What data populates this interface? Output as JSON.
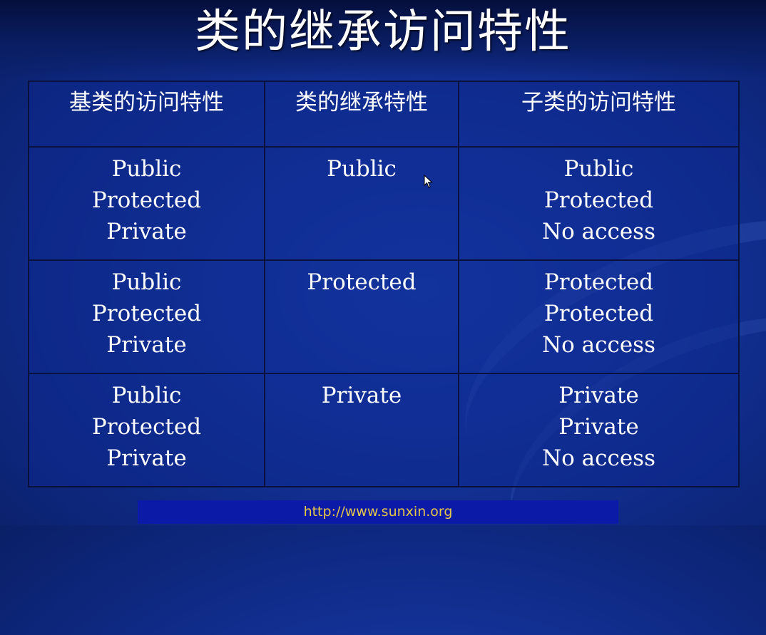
{
  "title": "类的继承访问特性",
  "table": {
    "headers": [
      "基类的访问特性",
      "类的继承特性",
      "子类的访问特性"
    ],
    "rows": [
      {
        "base": [
          "Public",
          "Protected",
          "Private"
        ],
        "inheritance": "Public",
        "derived": [
          "Public",
          "Protected",
          "No access"
        ]
      },
      {
        "base": [
          "Public",
          "Protected",
          "Private"
        ],
        "inheritance": "Protected",
        "derived": [
          "Protected",
          "Protected",
          "No access"
        ]
      },
      {
        "base": [
          "Public",
          "Protected",
          "Private"
        ],
        "inheritance": "Private",
        "derived": [
          "Private",
          "Private",
          "No access"
        ]
      }
    ]
  },
  "footer": {
    "url_text": "http://www.sunxin.org"
  },
  "colors": {
    "background": "#15359e",
    "footer_bar": "#0c1aa8",
    "footer_text": "#e3c64a",
    "grid_lines": "#08123c"
  },
  "icons": [
    "mouse-pointer-icon"
  ]
}
